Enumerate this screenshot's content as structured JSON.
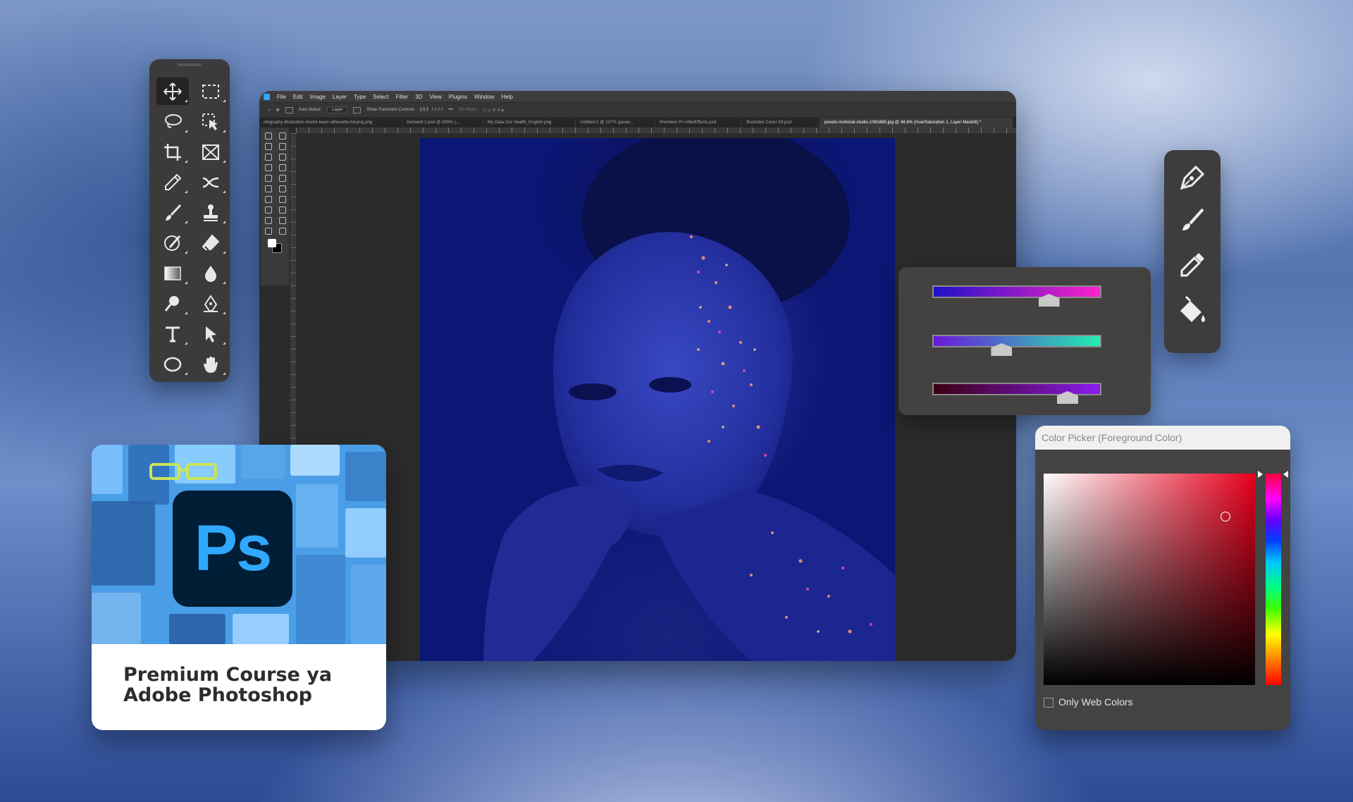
{
  "menubar": {
    "items": [
      "File",
      "Edit",
      "Image",
      "Layer",
      "Type",
      "Select",
      "Filter",
      "3D",
      "View",
      "Plugins",
      "Window",
      "Help"
    ]
  },
  "optionsbar": {
    "auto_select": "Auto-Select:",
    "layer_value": "Layer",
    "show_transform": "Show Transform Controls",
    "mode_3d": "3D Mode:"
  },
  "tabs": [
    "otography-illustration-doctor-team-silhouette-hd-png.png",
    "Demand 1.psd @ 200% (...",
    "My Data Our Health_English.png",
    "Untitled-1 @ 137% (pexel...",
    "Premiere Pr+AfterEffects.psd",
    "Illustrator Cover 43.psd",
    "pexels-motional-studio-1081685.jpg @ 48.8% (Hue/Saturation 1, Layer Mask/8) *"
  ],
  "toolbox_tools": [
    "move-tool-icon",
    "marquee-tool-icon",
    "lasso-tool-icon",
    "object-select-tool-icon",
    "crop-tool-icon",
    "frame-tool-icon",
    "eyedropper-tool-icon",
    "healing-tool-icon",
    "brush-tool-icon",
    "stamp-tool-icon",
    "history-brush-icon",
    "eraser-tool-icon",
    "gradient-tool-icon",
    "blur-tool-icon",
    "dodge-tool-icon",
    "pen-tool-icon",
    "type-tool-icon",
    "path-select-tool-icon",
    "ellipse-tool-icon",
    "hand-tool-icon"
  ],
  "hue_sliders": [
    {
      "gradient": [
        "#1d12c8",
        "#ff22c8"
      ],
      "position": 0.69
    },
    {
      "gradient": [
        "#6a18d8",
        "#22f0b0"
      ],
      "position": 0.41
    },
    {
      "gradient": [
        "#3a0012",
        "#8a1cf0"
      ],
      "position": 0.8
    }
  ],
  "brush_tools": [
    "pen-icon",
    "brush-icon",
    "eyedropper-icon",
    "paint-bucket-icon"
  ],
  "color_picker": {
    "title": "Color Picker (Foreground Color)",
    "only_web_colors": "Only Web Colors"
  },
  "course_card": {
    "logo": "Ps",
    "title_line1": "Premium Course ya",
    "title_line2": "Adobe Photoshop"
  },
  "colors": {
    "ps_blue": "#31a8ff",
    "ps_navy": "#001e36",
    "panel_dark": "#3b3b3b"
  }
}
